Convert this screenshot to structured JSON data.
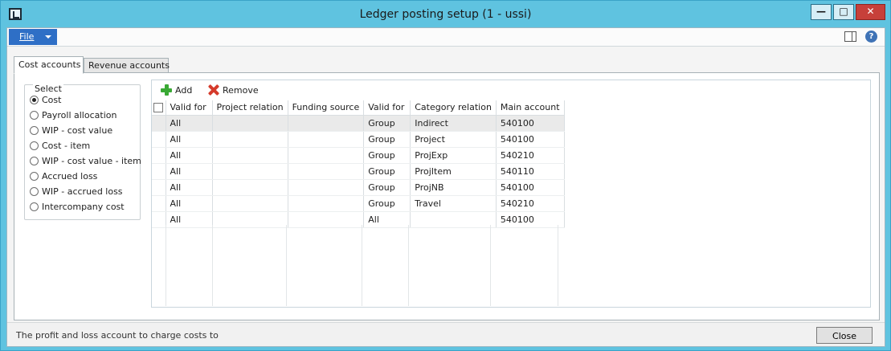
{
  "window": {
    "title": "Ledger posting setup (1 - ussi)",
    "min_glyph": "—",
    "max_glyph": "□",
    "close_glyph": "✕"
  },
  "menu": {
    "file_label": "File",
    "help_glyph": "?"
  },
  "tabs": [
    {
      "label": "Cost accounts",
      "active": true
    },
    {
      "label": "Revenue accounts",
      "active": false
    }
  ],
  "select_group": {
    "label": "Select",
    "options": [
      {
        "label": "Cost",
        "checked": true
      },
      {
        "label": "Payroll allocation",
        "checked": false
      },
      {
        "label": "WIP - cost value",
        "checked": false
      },
      {
        "label": "Cost - item",
        "checked": false
      },
      {
        "label": "WIP - cost value - item",
        "checked": false
      },
      {
        "label": "Accrued loss",
        "checked": false
      },
      {
        "label": "WIP - accrued loss",
        "checked": false
      },
      {
        "label": "Intercompany cost",
        "checked": false
      }
    ]
  },
  "toolbar": {
    "add_label": "Add",
    "remove_label": "Remove"
  },
  "grid": {
    "columns": [
      "Valid for",
      "Project relation",
      "Funding source",
      "Valid for",
      "Category relation",
      "Main account"
    ],
    "rows": [
      [
        "All",
        "",
        "",
        "Group",
        "Indirect",
        "540100"
      ],
      [
        "All",
        "",
        "",
        "Group",
        "Project",
        "540100"
      ],
      [
        "All",
        "",
        "",
        "Group",
        "ProjExp",
        "540210"
      ],
      [
        "All",
        "",
        "",
        "Group",
        "ProjItem",
        "540110"
      ],
      [
        "All",
        "",
        "",
        "Group",
        "ProjNB",
        "540100"
      ],
      [
        "All",
        "",
        "",
        "Group",
        "Travel",
        "540210"
      ],
      [
        "All",
        "",
        "",
        "All",
        "",
        "540100"
      ]
    ]
  },
  "status": {
    "text": "The profit and loss account to charge costs to",
    "close_label": "Close"
  }
}
